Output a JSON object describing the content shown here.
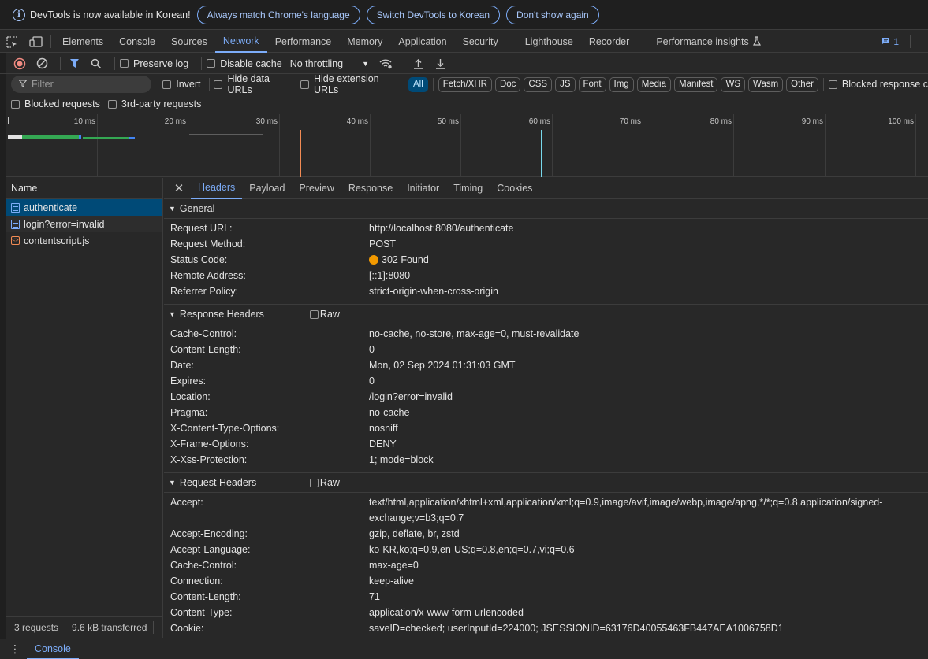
{
  "infobar": {
    "message": "DevTools is now available in Korean!",
    "btn_match": "Always match Chrome's language",
    "btn_switch": "Switch DevTools to Korean",
    "btn_dont_show": "Don't show again"
  },
  "tabs": [
    "Elements",
    "Console",
    "Sources",
    "Network",
    "Performance",
    "Memory",
    "Application",
    "Security",
    "Lighthouse",
    "Recorder",
    "Performance insights"
  ],
  "issues_count": "1",
  "toolbar": {
    "preserve_log": "Preserve log",
    "disable_cache": "Disable cache",
    "throttling": "No throttling"
  },
  "filter": {
    "placeholder": "Filter",
    "invert": "Invert",
    "hide_data_urls": "Hide data URLs",
    "hide_ext_urls": "Hide extension URLs",
    "chips": [
      "All",
      "Fetch/XHR",
      "Doc",
      "CSS",
      "JS",
      "Font",
      "Img",
      "Media",
      "Manifest",
      "WS",
      "Wasm",
      "Other"
    ],
    "blocked_response": "Blocked response c",
    "blocked_requests": "Blocked requests",
    "third_party": "3rd-party requests"
  },
  "overview": {
    "ticks": [
      "10 ms",
      "20 ms",
      "30 ms",
      "40 ms",
      "50 ms",
      "60 ms",
      "70 ms",
      "80 ms",
      "90 ms",
      "100 ms"
    ]
  },
  "requests": {
    "header": "Name",
    "items": [
      "authenticate",
      "login?error=invalid",
      "contentscript.js"
    ],
    "status_count": "3 requests",
    "status_transfer": "9.6 kB transferred"
  },
  "detail_tabs": [
    "Headers",
    "Payload",
    "Preview",
    "Response",
    "Initiator",
    "Timing",
    "Cookies"
  ],
  "general": {
    "title": "General",
    "rows": [
      {
        "k": "Request URL:",
        "v": "http://localhost:8080/authenticate"
      },
      {
        "k": "Request Method:",
        "v": "POST"
      },
      {
        "k": "Status Code:",
        "v": "302 Found"
      },
      {
        "k": "Remote Address:",
        "v": "[::1]:8080"
      },
      {
        "k": "Referrer Policy:",
        "v": "strict-origin-when-cross-origin"
      }
    ]
  },
  "response_headers": {
    "title": "Response Headers",
    "raw": "Raw",
    "rows": [
      {
        "k": "Cache-Control:",
        "v": "no-cache, no-store, max-age=0, must-revalidate"
      },
      {
        "k": "Content-Length:",
        "v": "0"
      },
      {
        "k": "Date:",
        "v": "Mon, 02 Sep 2024 01:31:03 GMT"
      },
      {
        "k": "Expires:",
        "v": "0"
      },
      {
        "k": "Location:",
        "v": "/login?error=invalid"
      },
      {
        "k": "Pragma:",
        "v": "no-cache"
      },
      {
        "k": "X-Content-Type-Options:",
        "v": "nosniff"
      },
      {
        "k": "X-Frame-Options:",
        "v": "DENY"
      },
      {
        "k": "X-Xss-Protection:",
        "v": "1; mode=block"
      }
    ]
  },
  "request_headers": {
    "title": "Request Headers",
    "raw": "Raw",
    "rows": [
      {
        "k": "Accept:",
        "v": "text/html,application/xhtml+xml,application/xml;q=0.9,image/avif,image/webp,image/apng,*/*;q=0.8,application/signed-exchange;v=b3;q=0.7"
      },
      {
        "k": "Accept-Encoding:",
        "v": "gzip, deflate, br, zstd"
      },
      {
        "k": "Accept-Language:",
        "v": "ko-KR,ko;q=0.9,en-US;q=0.8,en;q=0.7,vi;q=0.6"
      },
      {
        "k": "Cache-Control:",
        "v": "max-age=0"
      },
      {
        "k": "Connection:",
        "v": "keep-alive"
      },
      {
        "k": "Content-Length:",
        "v": "71"
      },
      {
        "k": "Content-Type:",
        "v": "application/x-www-form-urlencoded"
      },
      {
        "k": "Cookie:",
        "v": "saveID=checked; userInputId=224000; JSESSIONID=63176D40055463FB447AEA1006758D1"
      }
    ]
  },
  "drawer": {
    "tab": "Console"
  },
  "colors": {
    "accent": "#7cacf8",
    "status_302": "#f29900"
  }
}
